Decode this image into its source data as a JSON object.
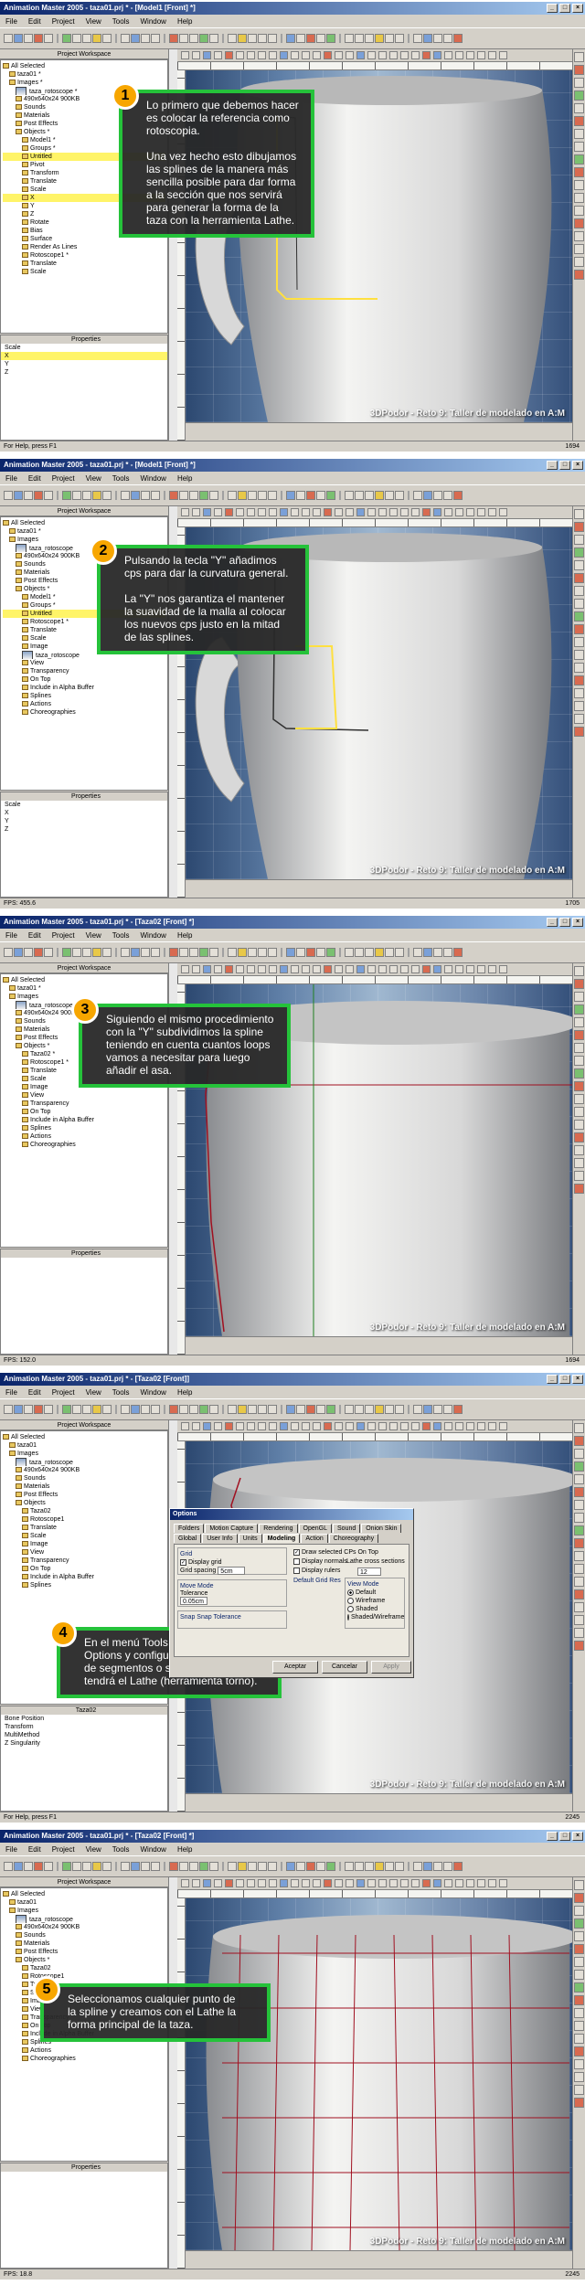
{
  "menu": [
    "File",
    "Edit",
    "Project",
    "View",
    "Tools",
    "Window",
    "Help"
  ],
  "panels": {
    "workspace": "Project Workspace",
    "properties": "Properties"
  },
  "watermark": "3DPodor - Reto 9: Taller de modelado en A:M",
  "colors": {
    "callout_border": "#25c23a",
    "badge": "#f7a600",
    "callout_bg": "#282828",
    "selection": "#fff468"
  },
  "frames": [
    {
      "title": "Animation Master 2005 - taza01.prj * - [Model1 [Front] *]",
      "tree": [
        "All Selected",
        "taza01 *",
        "Images *",
        "taza_rotoscope *",
        "490x640x24 900KB",
        "Sounds",
        "Materials",
        "Post Effects",
        "Objects *",
        "Model1 *",
        "Groups *",
        "Untitled",
        "Pivot",
        "Transform",
        "Translate",
        "Scale",
        "X",
        "Y",
        "Z",
        "Rotate",
        "Bias",
        "Surface",
        "Render As Lines",
        "Rotoscope1 *",
        "Translate",
        "Scale"
      ],
      "props": [
        "Properties",
        "Scale",
        "X",
        "Y",
        "Z"
      ],
      "status": "For Help, press F1",
      "status_right": "1694",
      "callout": {
        "num": "1",
        "lines": [
          "Lo primero que debemos hacer",
          "es colocar la referencia como",
          "rotoscopia.",
          "",
          "Una vez hecho esto dibujamos",
          "las splines de la manera más",
          "sencilla posible para dar forma",
          "a la sección que nos servirá",
          "para generar la forma de la",
          "taza con la herramienta Lathe."
        ]
      }
    },
    {
      "title": "Animation Master 2005 - taza01.prj * - [Model1 [Front] *]",
      "tree": [
        "All Selected",
        "taza01 *",
        "Images",
        "taza_rotoscope",
        "490x640x24 900KB",
        "Sounds",
        "Materials",
        "Post Effects",
        "Objects *",
        "Model1 *",
        "Groups *",
        "Untitled",
        "Rotoscope1 *",
        "Translate",
        "Scale",
        "Image",
        "taza_rotoscope",
        "View",
        "Transparency",
        "On Top",
        "Include in Alpha Buffer",
        "Splines",
        "Actions",
        "Choreographies"
      ],
      "props": [
        "Properties",
        "Scale",
        "X",
        "Y",
        "Z"
      ],
      "status": "FPS: 455.6",
      "status_right": "1705",
      "callout": {
        "num": "2",
        "lines": [
          "Pulsando la tecla \"Y\" añadimos",
          "cps para dar la curvatura general.",
          "",
          "La \"Y\" nos garantiza el mantener",
          "la suavidad de la malla al colocar",
          "los nuevos cps justo en la mitad",
          "de las splines."
        ]
      }
    },
    {
      "title": "Animation Master 2005 - taza01.prj * - [Taza02 [Front] *]",
      "tree": [
        "All Selected",
        "taza01 *",
        "Images",
        "taza_rotoscope",
        "490x640x24 900KB",
        "Sounds",
        "Materials",
        "Post Effects",
        "Objects *",
        "Taza02 *",
        "Rotoscope1 *",
        "Translate",
        "Scale",
        "Image",
        "View",
        "Transparency",
        "On Top",
        "Include in Alpha Buffer",
        "Splines",
        "Actions",
        "Choreographies"
      ],
      "props": [
        "Properties"
      ],
      "status": "FPS: 152.0",
      "status_right": "1694",
      "callout": {
        "num": "3",
        "lines": [
          "Siguiendo el mismo procedimiento",
          "con la \"Y\" subdividimos la spline",
          "teniendo en cuenta cuantos loops",
          "vamos a necesitar para luego",
          "añadir el asa."
        ]
      }
    },
    {
      "title": "Animation Master 2005 - taza01.prj * - [Taza02 [Front]]",
      "tree": [
        "All Selected",
        "taza01",
        "Images",
        "taza_rotoscope",
        "490x640x24 900KB",
        "Sounds",
        "Materials",
        "Post Effects",
        "Objects",
        "Taza02",
        "Rotoscope1",
        "Translate",
        "Scale",
        "Image",
        "View",
        "Transparency",
        "On Top",
        "Include in Alpha Buffer",
        "Splines"
      ],
      "props": [
        "Taza02",
        "Bone Position",
        "Transform",
        "MultiMethod",
        "Z Singularity"
      ],
      "status": "For Help, press F1",
      "status_right": "2245",
      "callout": {
        "num": "4",
        "lines": [
          "En el menú Tools pulsamos en",
          "Options y configuramos el número",
          "de segmentos o secciones que",
          "tendrá el Lathe (herramienta torno)."
        ]
      },
      "dialog": {
        "title": "Options",
        "tabs": [
          "Folders",
          "Motion Capture",
          "Rendering",
          "OpenGL",
          "Sound",
          "Onion Skin",
          "Global",
          "User Info",
          "Units",
          "Modeling",
          "Action",
          "Choreography"
        ],
        "active_tab": "Modeling",
        "grid_label": "Grid",
        "display_grid": "Display grid",
        "grid_spacing": "Grid spacing",
        "grid_value": "5cm",
        "move_mode": "Move Mode",
        "tolerance": "Tolerance",
        "tolerance_value": "0.05cm",
        "snap": "Snap Snap Tolerance",
        "draw_cps": "Draw selected CPs On Top",
        "display_normals": "Display normals",
        "display_rulers": "Display rulers",
        "lathe_label": "Lathe cross sections",
        "lathe_value": "12",
        "default_grid": "Default Grid Res",
        "view_mode": "View Mode",
        "modes": [
          "Default",
          "Wireframe",
          "Shaded",
          "Shaded/Wireframe"
        ],
        "ok": "Aceptar",
        "cancel": "Cancelar",
        "apply": "Apply"
      }
    },
    {
      "title": "Animation Master 2005 - taza01.prj * - [Taza02 [Front] *]",
      "tree": [
        "All Selected",
        "taza01",
        "Images",
        "taza_rotoscope",
        "490x640x24 900KB",
        "Sounds",
        "Materials",
        "Post Effects",
        "Objects *",
        "Taza02",
        "Rotoscope1",
        "Translate",
        "Scale",
        "Image",
        "View",
        "Transparency",
        "On Top",
        "Include in Alpha Buffer",
        "Splines",
        "Actions",
        "Choreographies"
      ],
      "props": [
        "Properties"
      ],
      "status": "FPS: 18.8",
      "status_right": "2245",
      "callout": {
        "num": "5",
        "lines": [
          "Seleccionamos cualquier punto de",
          "la spline y creamos con el Lathe la",
          "forma principal de la taza."
        ]
      }
    }
  ]
}
